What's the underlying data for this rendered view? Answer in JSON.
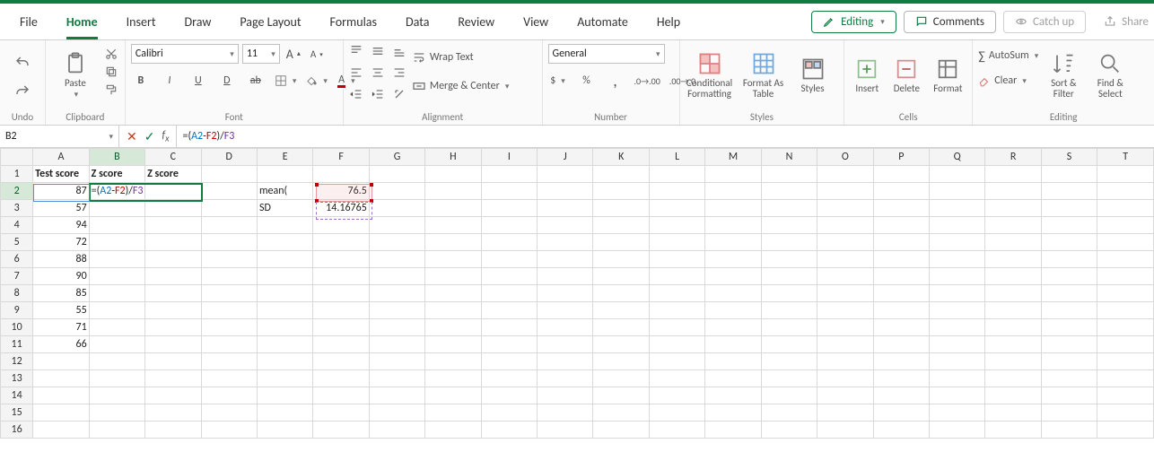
{
  "tabs": {
    "items": [
      "File",
      "Home",
      "Insert",
      "Draw",
      "Page Layout",
      "Formulas",
      "Data",
      "Review",
      "View",
      "Automate",
      "Help"
    ],
    "active": "Home"
  },
  "topRight": {
    "editing": "Editing",
    "comments": "Comments",
    "catchup": "Catch up",
    "share": "Share"
  },
  "ribbon": {
    "undo_label": "Undo",
    "clipboard": {
      "paste": "Paste",
      "label": "Clipboard"
    },
    "font": {
      "name": "Calibri",
      "size": "11",
      "label": "Font"
    },
    "alignment": {
      "wrap": "Wrap Text",
      "merge": "Merge & Center",
      "label": "Alignment"
    },
    "number": {
      "format": "General",
      "label": "Number"
    },
    "styles": {
      "cond": "Conditional Formatting",
      "fat": "Format As Table",
      "styles": "Styles",
      "label": "Styles"
    },
    "cells": {
      "insert": "Insert",
      "delete": "Delete",
      "format": "Format",
      "label": "Cells"
    },
    "editing": {
      "autosum": "AutoSum",
      "clear": "Clear",
      "sort": "Sort & Filter",
      "find": "Find & Select",
      "label": "Editing"
    }
  },
  "formulaBar": {
    "nameBox": "B2",
    "formula_plain": "=(A2-F2)/F3",
    "formula_parts": [
      {
        "t": "op",
        "v": "=("
      },
      {
        "t": "ref",
        "v": "A2",
        "c": "blue"
      },
      {
        "t": "op",
        "v": "-"
      },
      {
        "t": "ref",
        "v": "F2",
        "c": "red"
      },
      {
        "t": "op",
        "v": ")/"
      },
      {
        "t": "ref",
        "v": "F3",
        "c": "purple"
      }
    ]
  },
  "sheet": {
    "columns": [
      "A",
      "B",
      "C",
      "D",
      "E",
      "F",
      "G",
      "H",
      "I",
      "J",
      "K",
      "L",
      "M",
      "N",
      "O",
      "P",
      "Q",
      "R",
      "S",
      "T"
    ],
    "rows": 16,
    "headers": {
      "A1": "Test score",
      "B1": "Z score",
      "C1": "Z score"
    },
    "colA": [
      "87",
      "57",
      "94",
      "72",
      "88",
      "90",
      "85",
      "55",
      "71",
      "66"
    ],
    "E2": "mean(",
    "E3": "SD",
    "F2": "76.5",
    "F3": "14.16765",
    "editing_cell": "B2",
    "editing_display_parts": [
      {
        "t": "op",
        "v": "=("
      },
      {
        "t": "ref",
        "v": "A2",
        "c": "blue"
      },
      {
        "t": "op",
        "v": "-"
      },
      {
        "t": "ref",
        "v": "F2",
        "c": "red"
      },
      {
        "t": "op",
        "v": ")/"
      },
      {
        "t": "ref",
        "v": "F3",
        "c": "purple"
      }
    ]
  }
}
